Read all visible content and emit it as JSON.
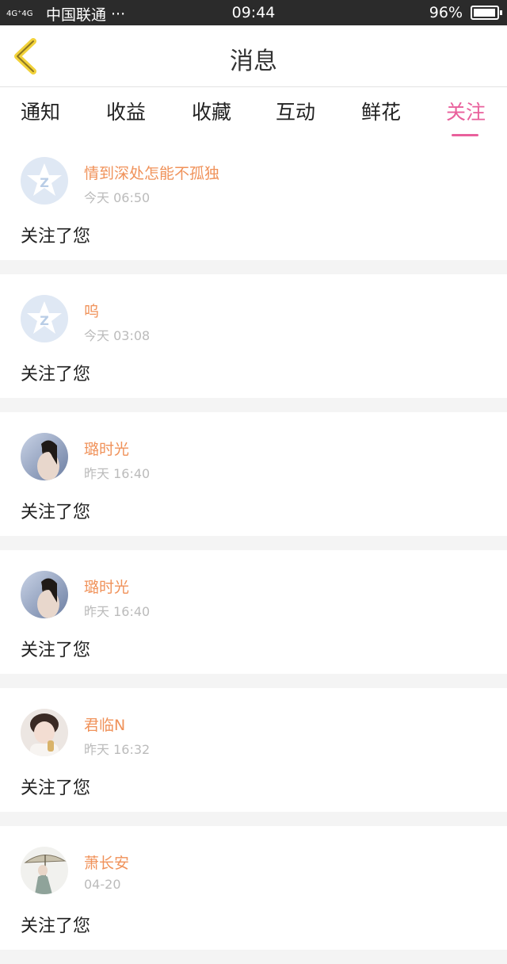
{
  "status_bar": {
    "network": "4G⁺4G",
    "carrier": "中国联通",
    "dots": "···",
    "time": "09:44",
    "battery_percent": "96%",
    "battery_level": 0.96
  },
  "header": {
    "title": "消息"
  },
  "tabs": [
    {
      "label": "通知"
    },
    {
      "label": "收益"
    },
    {
      "label": "收藏"
    },
    {
      "label": "互动"
    },
    {
      "label": "鲜花"
    },
    {
      "label": "关注"
    }
  ],
  "active_tab": "关注",
  "messages": [
    {
      "name": "情到深处怎能不孤独",
      "time": "今天 06:50",
      "text": "关注了您",
      "avatar": "qq-default-avatar"
    },
    {
      "name": "呜",
      "time": "今天 03:08",
      "text": "关注了您",
      "avatar": "qq-default-avatar"
    },
    {
      "name": "璐时光",
      "time": "昨天 16:40",
      "text": "关注了您",
      "avatar": "photo-avatar"
    },
    {
      "name": "璐时光",
      "time": "昨天 16:40",
      "text": "关注了您",
      "avatar": "photo-avatar"
    },
    {
      "name": "君临N",
      "time": "昨天 16:32",
      "text": "关注了您",
      "avatar": "photo-avatar"
    },
    {
      "name": "萧长安",
      "time": "04-20",
      "text": "关注了您",
      "avatar": "photo-avatar"
    }
  ],
  "colors": {
    "accent": "#e9609c",
    "name": "#f0925a",
    "back_arrow": "#f2d23a"
  }
}
